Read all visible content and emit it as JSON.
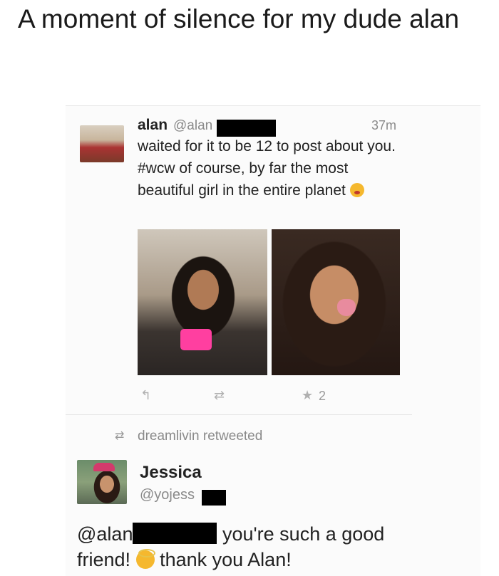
{
  "caption": "A moment of silence for my dude alan",
  "tweet1": {
    "name": "alan",
    "handle": "@alan",
    "time": "37m",
    "text": "waited for it to be 12 to post about you. #wcw of course, by far the most beautiful girl in the entire planet",
    "favorite_count": "2"
  },
  "retweet_line": "dreamlivin retweeted",
  "tweet2": {
    "name": "Jessica",
    "handle": "@yojess",
    "mention": "@alan",
    "text_after_mention": "you're such a good friend!",
    "text_after_emoji": "thank you Alan!"
  },
  "icons": {
    "reply": "reply-icon",
    "retweet": "retweet-icon",
    "favorite": "star-icon",
    "emoji1": "heart-kiss-emoji-icon",
    "emoji2": "halo-emoji-icon"
  }
}
